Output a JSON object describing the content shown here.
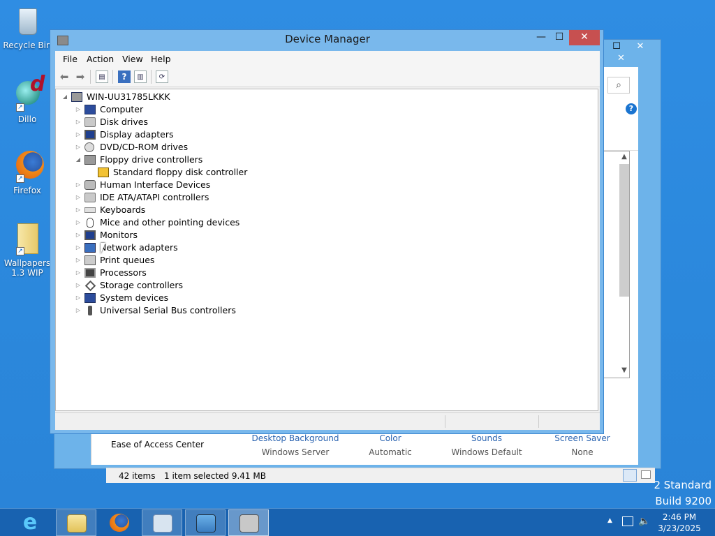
{
  "desktop": {
    "icons": [
      {
        "label": "Recycle Bin",
        "icon": "recycle-bin-icon"
      },
      {
        "label": "Dillo",
        "icon": "dillo-icon"
      },
      {
        "label": "Firefox",
        "icon": "firefox-icon"
      },
      {
        "label": "Wallpapers\n1.3 WIP",
        "icon": "folder-icon"
      }
    ],
    "watermark_line1": "2 Standard",
    "watermark_line2": "Build 9200"
  },
  "background_window": {
    "ease_of_access": "Ease of Access Center",
    "columns": [
      {
        "title": "Desktop Background",
        "value": "Windows Server"
      },
      {
        "title": "Color",
        "value": "Automatic"
      },
      {
        "title": "Sounds",
        "value": "Windows Default"
      },
      {
        "title": "Screen Saver",
        "value": "None"
      }
    ],
    "status_items": "42 items",
    "status_selected": "1 item selected  9.41 MB"
  },
  "device_manager": {
    "title": "Device Manager",
    "menu": [
      "File",
      "Action",
      "View",
      "Help"
    ],
    "root": "WIN-UU31785LKKK",
    "items": [
      {
        "label": "Computer",
        "icon": "computer-icon",
        "expanded": false
      },
      {
        "label": "Disk drives",
        "icon": "disk-drive-icon",
        "expanded": false
      },
      {
        "label": "Display adapters",
        "icon": "display-adapter-icon",
        "expanded": false
      },
      {
        "label": "DVD/CD-ROM drives",
        "icon": "dvd-icon",
        "expanded": false
      },
      {
        "label": "Floppy drive controllers",
        "icon": "floppy-controller-icon",
        "expanded": true
      },
      {
        "label": "Standard floppy disk controller",
        "icon": "warning-device-icon",
        "child": true
      },
      {
        "label": "Human Interface Devices",
        "icon": "hid-icon",
        "expanded": false
      },
      {
        "label": "IDE ATA/ATAPI controllers",
        "icon": "ide-controller-icon",
        "expanded": false
      },
      {
        "label": "Keyboards",
        "icon": "keyboard-icon",
        "expanded": false
      },
      {
        "label": "Mice and other pointing devices",
        "icon": "mouse-icon",
        "expanded": false
      },
      {
        "label": "Monitors",
        "icon": "monitor-icon",
        "expanded": false
      },
      {
        "label": "Network adapters",
        "icon": "network-adapter-icon",
        "expanded": false
      },
      {
        "label": "Print queues",
        "icon": "printer-icon",
        "expanded": false
      },
      {
        "label": "Processors",
        "icon": "processor-icon",
        "expanded": false
      },
      {
        "label": "Storage controllers",
        "icon": "storage-controller-icon",
        "expanded": false
      },
      {
        "label": "System devices",
        "icon": "system-devices-icon",
        "expanded": false
      },
      {
        "label": "Universal Serial Bus controllers",
        "icon": "usb-icon",
        "expanded": false
      }
    ]
  },
  "taskbar": {
    "apps": [
      {
        "name": "internet-explorer",
        "icon": "internet-explorer-icon"
      },
      {
        "name": "file-explorer",
        "icon": "file-explorer-icon"
      },
      {
        "name": "firefox",
        "icon": "firefox-icon"
      },
      {
        "name": "server-manager",
        "icon": "server-manager-icon"
      },
      {
        "name": "control-panel",
        "icon": "control-panel-icon"
      },
      {
        "name": "device-manager",
        "icon": "device-manager-icon"
      }
    ],
    "time": "2:46 PM",
    "date": "3/23/2025"
  },
  "colors": {
    "desktop": "#2d8ce0",
    "window_frame": "#79b8ec",
    "close_button": "#c75050",
    "taskbar": "#1862b0"
  }
}
